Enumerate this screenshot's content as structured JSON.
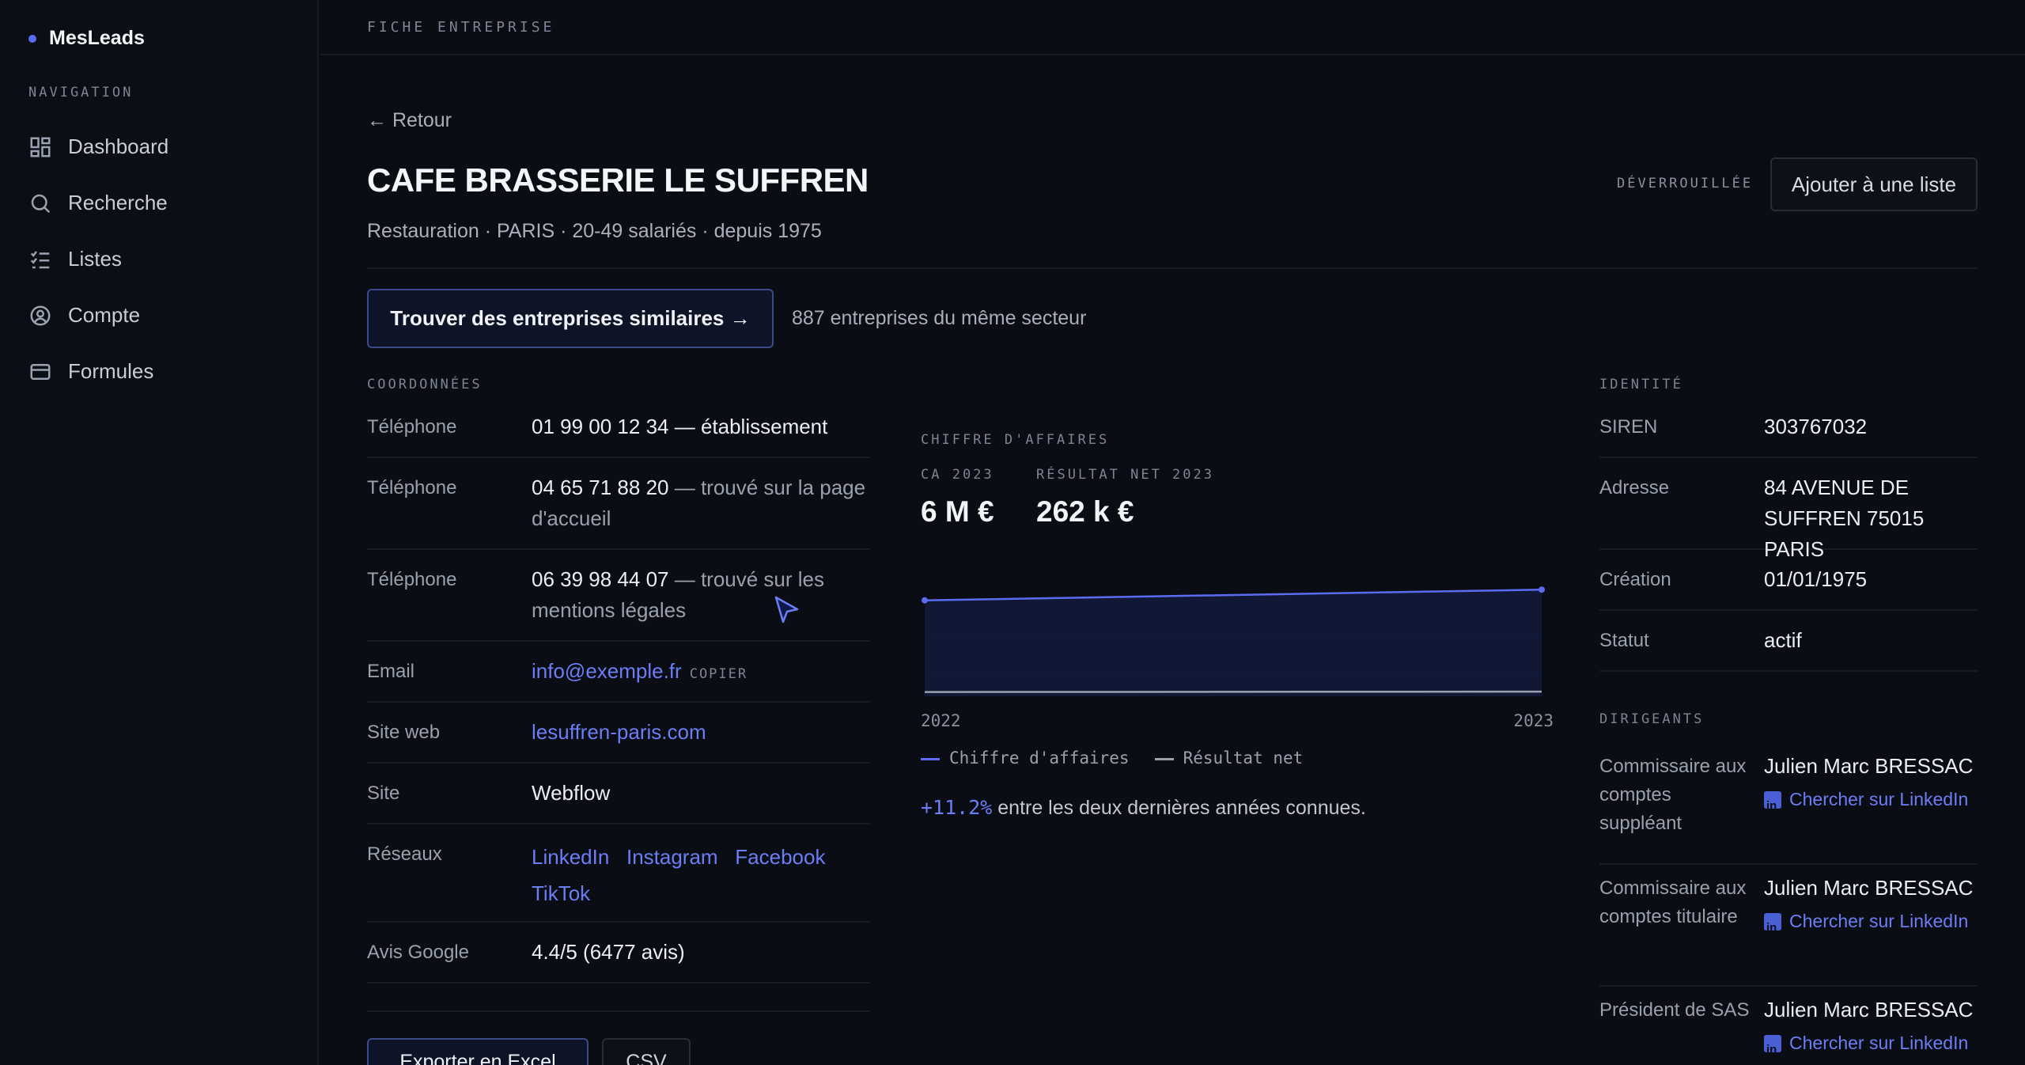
{
  "sidebar": {
    "brand": "MesLeads",
    "nav_label": "NAVIGATION",
    "items": [
      {
        "label": "Dashboard",
        "icon": "grid-icon"
      },
      {
        "label": "Recherche",
        "icon": "search-icon"
      },
      {
        "label": "Listes",
        "icon": "list-check-icon"
      },
      {
        "label": "Compte",
        "icon": "user-circle-icon"
      },
      {
        "label": "Formules",
        "icon": "card-icon"
      }
    ]
  },
  "topbar": {
    "title": "FICHE ENTREPRISE"
  },
  "header": {
    "back": "← Retour",
    "name": "CAFE BRASSERIE LE SUFFREN",
    "subtitle": "Restauration · PARIS · 20-49 salariés · depuis 1975",
    "status": "DÉVERROUILLÉE",
    "add_list": "Ajouter à une liste"
  },
  "similar": {
    "button": "Trouver des entreprises similaires →",
    "count": "887 entreprises du même secteur"
  },
  "contact": {
    "title": "COORDONNÉES",
    "rows": [
      {
        "label": "Téléphone",
        "value": "01 99 00 12 34",
        "note": " — établissement"
      },
      {
        "label": "Téléphone",
        "value": "04 65 71 88 20",
        "note": " — trouvé sur la page d'accueil"
      },
      {
        "label": "Téléphone",
        "value": "06 39 98 44 07",
        "note": " — trouvé sur les mentions légales"
      },
      {
        "label": "Email",
        "value": "info@exemple.fr",
        "action": "COPIER"
      },
      {
        "label": "Site web",
        "value": "lesuffren-paris.com"
      },
      {
        "label": "Site",
        "value": "Webflow"
      },
      {
        "label": "Réseaux",
        "links": [
          "LinkedIn",
          "Instagram",
          "Facebook",
          "TikTok"
        ]
      },
      {
        "label": "Avis Google",
        "value": "4.4/5 (6477 avis)"
      }
    ]
  },
  "finance": {
    "title": "CHIFFRE D'AFFAIRES",
    "ca_label": "CA 2023",
    "ca_value": "6 M €",
    "net_label": "RÉSULTAT NET 2023",
    "net_value": "262 k €",
    "legend_ca": "Chiffre d'affaires",
    "legend_net": "Résultat net",
    "growth_pct": "+11.2%",
    "growth_text": " entre les deux dernières années connues."
  },
  "chart_data": {
    "type": "area",
    "x": [
      "2022",
      "2023"
    ],
    "series": [
      {
        "name": "Chiffre d'affaires",
        "values": [
          5.4,
          6.0
        ],
        "color": "#5b6cf0"
      },
      {
        "name": "Résultat net",
        "values": [
          0.24,
          0.262
        ],
        "color": "#9aa1ae"
      }
    ],
    "ylim": [
      0,
      6.5
    ]
  },
  "identity": {
    "title": "IDENTITÉ",
    "rows": [
      {
        "label": "SIREN",
        "value": "303767032"
      },
      {
        "label": "Adresse",
        "value": "84 AVENUE DE SUFFREN 75015 PARIS"
      },
      {
        "label": "Création",
        "value": "01/01/1975"
      },
      {
        "label": "Statut",
        "value": "actif"
      }
    ]
  },
  "dirigeants": {
    "title": "DIRIGEANTS",
    "link_label": "Chercher sur LinkedIn",
    "rows": [
      {
        "role": "Commissaire aux comptes suppléant",
        "name": "Julien Marc BRESSAC"
      },
      {
        "role": "Commissaire aux comptes titulaire",
        "name": "Julien Marc BRESSAC"
      },
      {
        "role": "Président de SAS",
        "name": "Julien Marc BRESSAC"
      }
    ]
  },
  "actions": {
    "export": "Exporter en Excel",
    "csv": "CSV"
  }
}
